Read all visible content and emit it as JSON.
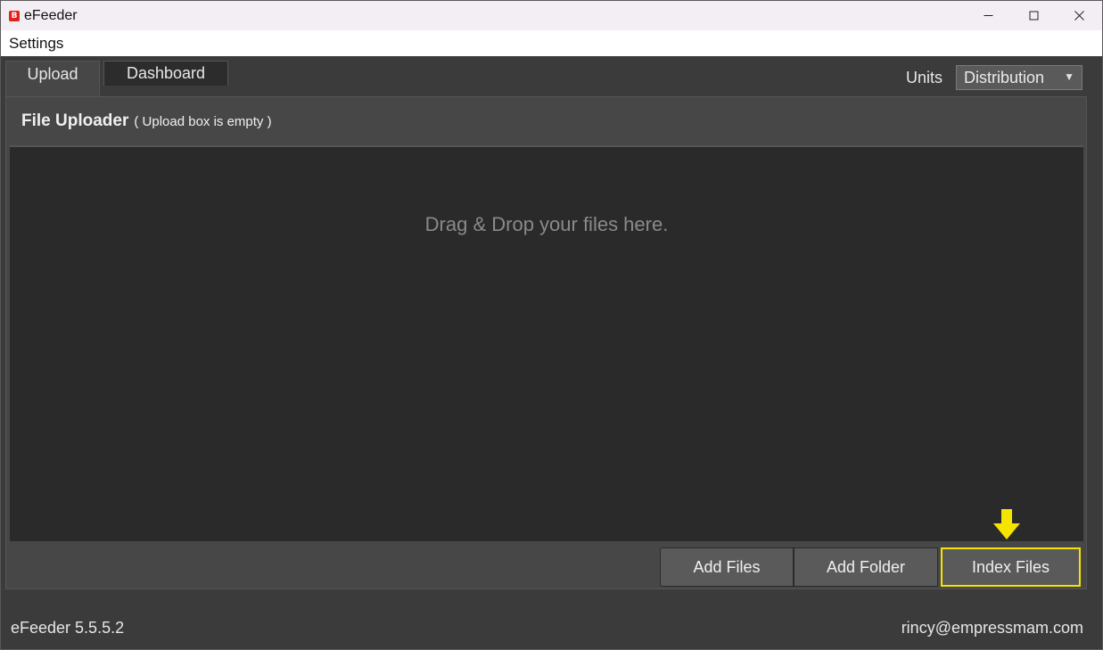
{
  "window": {
    "title": "eFeeder",
    "icon": "efeeder-app-icon",
    "icon_glyph": "B",
    "controls": [
      "minimize",
      "maximize",
      "close"
    ]
  },
  "menu": {
    "settings_label": "Settings"
  },
  "tabs": [
    {
      "label": "Upload",
      "active": true
    },
    {
      "label": "Dashboard",
      "active": false
    }
  ],
  "units": {
    "label": "Units",
    "selected": "Distribution"
  },
  "uploader": {
    "title": "File Uploader",
    "status": "( Upload box is empty )",
    "drop_hint": "Drag & Drop your files here.",
    "buttons": {
      "add_files": "Add Files",
      "add_folder": "Add Folder",
      "index_files": "Index Files"
    },
    "highlight_color": "#f5e400"
  },
  "footer": {
    "version": "eFeeder 5.5.5.2",
    "user_email": "rincy@empressmam.com"
  }
}
